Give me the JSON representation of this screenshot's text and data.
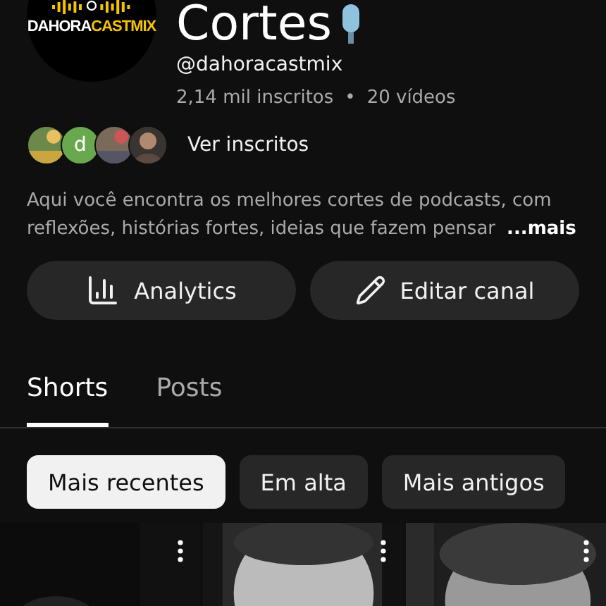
{
  "channel": {
    "logo": {
      "text_1": "DAHORA",
      "text_2": "CASTMIX"
    },
    "title": "Cortes",
    "handle": "@dahoracastmix",
    "subscribers": "2,14 mil inscritos",
    "separator": "•",
    "videos": "20 vídeos"
  },
  "subscriber_avatars": [
    {
      "kind": "picture"
    },
    {
      "kind": "letter",
      "letter": "d",
      "color": "#6aa84f"
    },
    {
      "kind": "picture"
    },
    {
      "kind": "figure"
    }
  ],
  "view_subscribers": "Ver inscritos",
  "description": {
    "text": "Aqui você encontra os melhores cortes de podcasts, com reflexões, histórias fortes, ideias que fazem pensar",
    "more": "...mais"
  },
  "actions": [
    {
      "kind": "analytics",
      "label": "Analytics"
    },
    {
      "kind": "edit",
      "label": "Editar canal"
    }
  ],
  "tabs": [
    {
      "label": "Shorts",
      "selected": true
    },
    {
      "label": "Posts",
      "selected": false
    }
  ],
  "filters": [
    {
      "label": "Mais recentes",
      "selected": true
    },
    {
      "label": "Em alta",
      "selected": false
    },
    {
      "label": "Mais antigos",
      "selected": false
    }
  ],
  "shorts": [
    {
      "kind": "picture"
    },
    {
      "kind": "picture"
    },
    {
      "kind": "picture"
    }
  ]
}
